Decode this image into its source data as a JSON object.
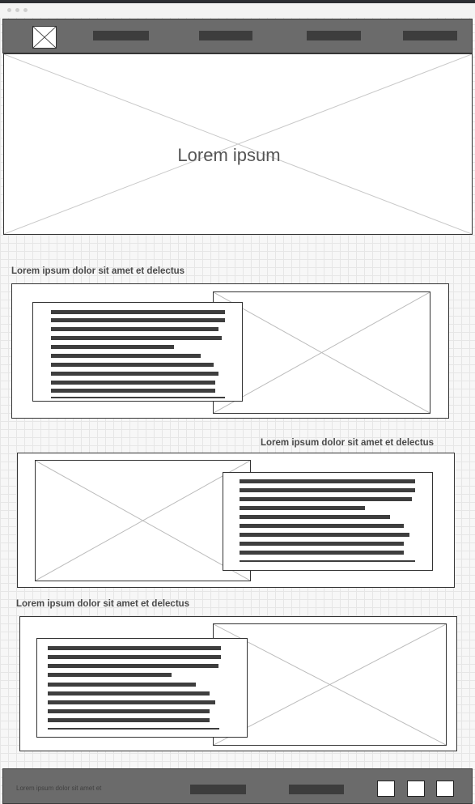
{
  "window": {
    "dots": [
      "close",
      "minimize",
      "maximize"
    ]
  },
  "header": {
    "logo_icon": "image-placeholder-icon",
    "nav_items": 4
  },
  "hero": {
    "title": "Lorem ipsum"
  },
  "sections": [
    {
      "caption": "Lorem ipsum dolor sit amet et delectus",
      "text_lines": 10
    },
    {
      "caption": "Lorem ipsum dolor sit amet et delectus",
      "text_lines": 10
    },
    {
      "caption": "Lorem ipsum dolor sit amet et delectus",
      "text_lines": 10
    }
  ],
  "footer": {
    "text": "Lorem ipsum dolor sit amet et",
    "nav_items": 2,
    "buttons": 3
  },
  "colors": {
    "topbar": "#2d2f33",
    "header_bg": "#6b6b6b",
    "footer_bg": "#6b6b6b",
    "bar": "#3e3e3e",
    "grid": "#e6e6e6"
  }
}
